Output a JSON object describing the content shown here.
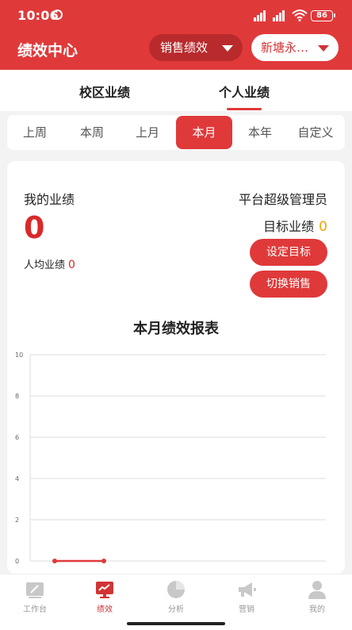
{
  "status_bar": {
    "time": "10:06",
    "signal_1": "⁴ᴳ",
    "signal_2": "⁴ᴳ",
    "battery": "86"
  },
  "header": {
    "title": "绩效中心",
    "type_select": "销售绩效",
    "school_select": "新塘永…"
  },
  "main_tabs": [
    {
      "label": "校区业绩",
      "active": false
    },
    {
      "label": "个人业绩",
      "active": true
    }
  ],
  "period_tabs": [
    {
      "label": "上周",
      "active": false
    },
    {
      "label": "本周",
      "active": false
    },
    {
      "label": "上月",
      "active": false
    },
    {
      "label": "本月",
      "active": true
    },
    {
      "label": "本年",
      "active": false
    },
    {
      "label": "自定义",
      "active": false
    }
  ],
  "summary": {
    "my_label": "我的业绩",
    "my_value": "0",
    "avg_label": "人均业绩",
    "avg_value": "0",
    "role": "平台超级管理员",
    "target_label": "目标业绩",
    "target_value": "0",
    "set_target_button": "设定目标",
    "switch_sales_button": "切换销售"
  },
  "chart_data": {
    "type": "line",
    "title": "本月绩效报表",
    "xlabel": "",
    "ylabel": "",
    "ylim": [
      0,
      10
    ],
    "yticks": [
      "0",
      "2",
      "4",
      "6",
      "8",
      "10"
    ],
    "grid": true,
    "series": [
      {
        "values": [
          0,
          0
        ]
      }
    ],
    "color": "#e0393a"
  },
  "bottom_nav": [
    {
      "label": "工作台",
      "icon": "workbench-icon",
      "active": false
    },
    {
      "label": "绩效",
      "icon": "performance-icon",
      "active": true
    },
    {
      "label": "分析",
      "icon": "analysis-icon",
      "active": false
    },
    {
      "label": "营销",
      "icon": "marketing-icon",
      "active": false
    },
    {
      "label": "我的",
      "icon": "profile-icon",
      "active": false
    }
  ],
  "colors": {
    "brand": "#e0393a",
    "accent": "#f0a500",
    "value_red": "#d9292a"
  }
}
